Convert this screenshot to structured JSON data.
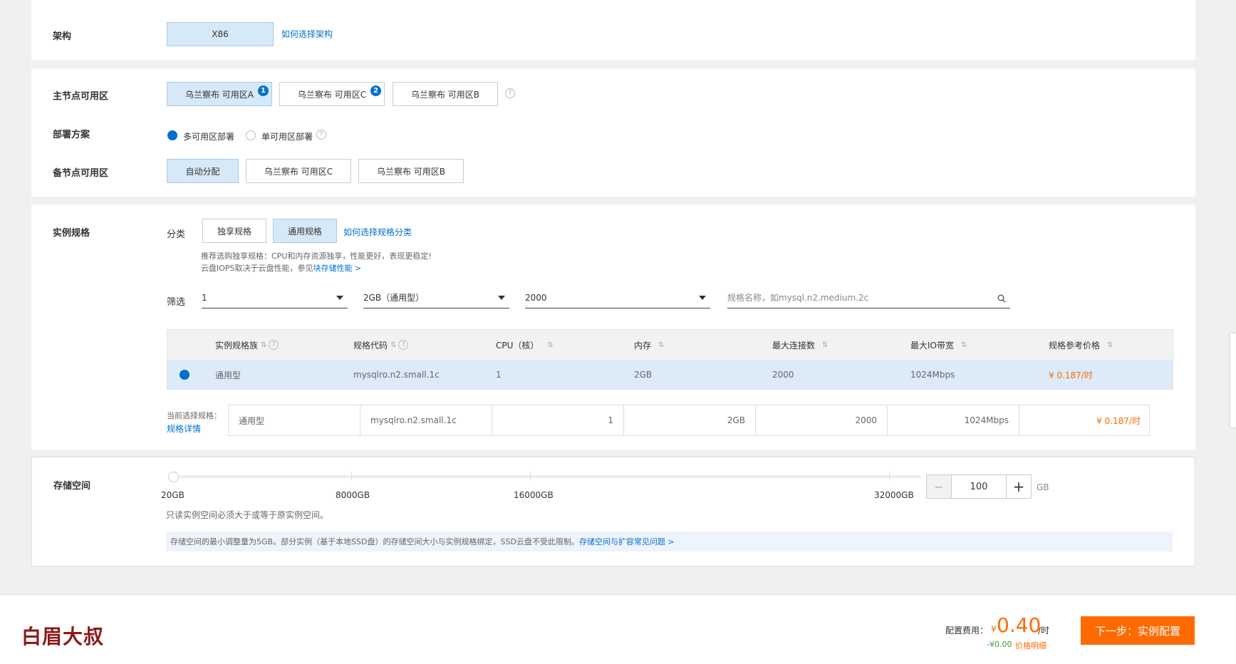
{
  "arch": {
    "label": "架构",
    "value": "X86",
    "help_link": "如何选择架构"
  },
  "zone": {
    "primary_label": "主节点可用区",
    "primary_options": [
      {
        "text": "乌兰察布 可用区A",
        "badge": "1"
      },
      {
        "text": "乌兰察布 可用区C",
        "badge": "2"
      },
      {
        "text": "乌兰察布 可用区B",
        "badge": ""
      }
    ],
    "deploy_label": "部署方案",
    "deploy_multi": "多可用区部署",
    "deploy_single": "单可用区部署",
    "backup_label": "备节点可用区",
    "backup_options": [
      "自动分配",
      "乌兰察布 可用区C",
      "乌兰察布 可用区B"
    ]
  },
  "spec": {
    "label": "实例规格",
    "category_label": "分类",
    "category_dedicated": "独享规格",
    "category_general": "通用规格",
    "category_help_link": "如何选择规格分类",
    "tip_line1": "推荐选购独享规格：CPU和内存资源独享，性能更好，表现更稳定!",
    "tip_line2_prefix": "云盘IOPS取决于云盘性能，参见",
    "tip_line2_link": "块存储性能 >",
    "filter_label": "筛选",
    "filter_cpu": "1",
    "filter_mem": "2GB（通用型）",
    "filter_conn": "2000",
    "search_placeholder": "规格名称，如mysql.n2.medium.2c",
    "table": {
      "headers": [
        "实例规格族",
        "规格代码",
        "CPU（核）",
        "内存",
        "最大连接数",
        "最大IO带宽",
        "规格参考价格"
      ],
      "row": {
        "family": "通用型",
        "code": "mysqlro.n2.small.1c",
        "cpu": "1",
        "mem": "2GB",
        "conn": "2000",
        "io": "1024Mbps",
        "price": "¥ 0.187/时"
      }
    },
    "current_label": "当前选择规格：",
    "current_detail_link": "规格详情",
    "current": {
      "family": "通用型",
      "code": "mysqlro.n2.small.1c",
      "cpu": "1",
      "mem": "2GB",
      "conn": "2000",
      "io": "1024Mbps",
      "price": "¥ 0.187/时"
    }
  },
  "storage": {
    "label": "存储空间",
    "ticks": [
      "20GB",
      "8000GB",
      "16000GB",
      "32000GB"
    ],
    "value": "100",
    "unit": "GB",
    "minus": "−",
    "plus": "+",
    "note": "只读实例空间必须大于或等于原实例空间。",
    "info": "存储空间的最小调整量为5GB。部分实例（基于本地SSD盘）的存储空间大小与实例规格绑定，SSD云盘不受此限制。",
    "info_link": "存储空间与扩容常见问题 >"
  },
  "footer": {
    "logo": "白眉大叔",
    "fee_label": "配置费用：",
    "currency": "¥",
    "price": "0.40",
    "unit": "/时",
    "discount": "-¥0.00",
    "detail_link": "价格明细",
    "next_button": "下一步：实例配置"
  },
  "colors": {
    "accent": "#0070cc",
    "price": "#ff6a00",
    "button": "#ff6a00",
    "discount": "#3d9a3d",
    "logo": "#8b1a1a"
  }
}
